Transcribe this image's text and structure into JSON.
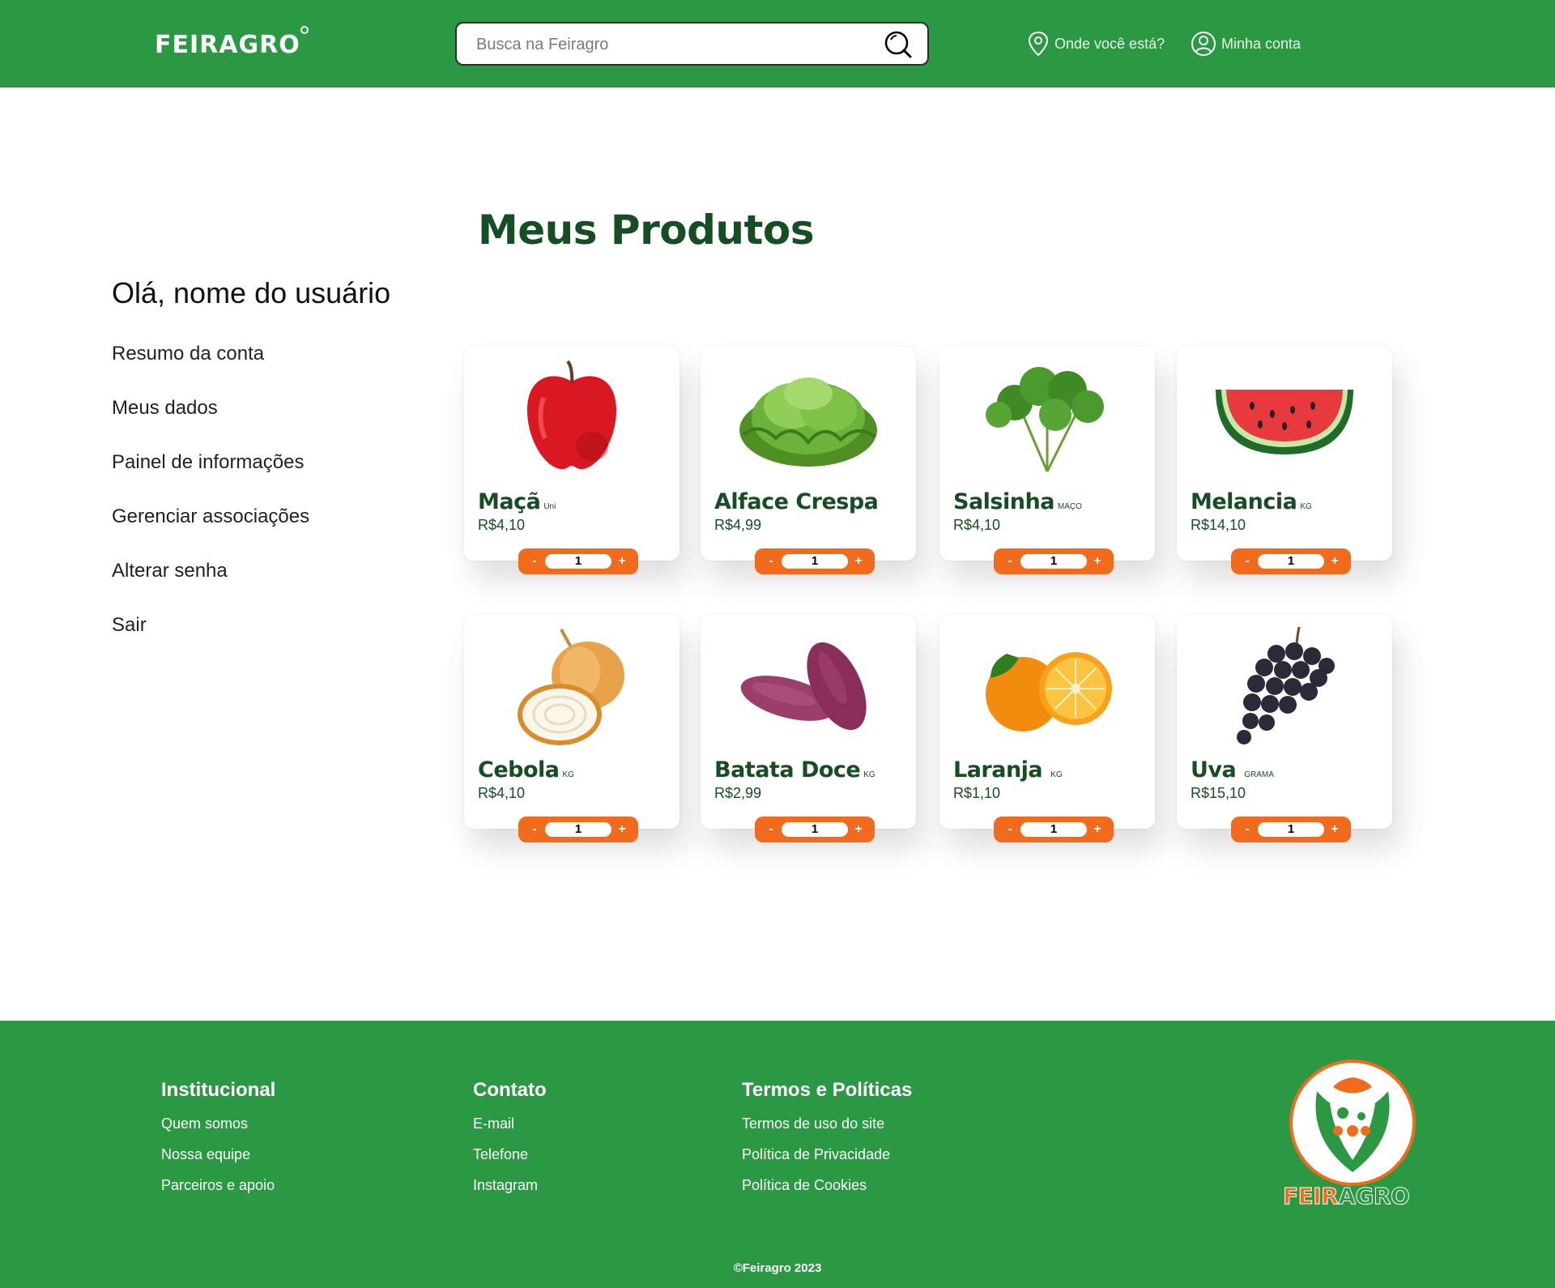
{
  "header": {
    "logo": "FEIRAGRO",
    "search_placeholder": "Busca na Feiragro",
    "location_label": "Onde você está?",
    "account_label": "Minha conta"
  },
  "sidebar": {
    "greeting": "Olá, nome do usuário",
    "items": [
      {
        "label": "Resumo da conta"
      },
      {
        "label": "Meus dados"
      },
      {
        "label": "Painel de informações"
      },
      {
        "label": "Gerenciar associações"
      },
      {
        "label": "Alterar senha"
      },
      {
        "label": "Sair"
      }
    ]
  },
  "main": {
    "title": "Meus Produtos",
    "products": [
      {
        "name": "Maçã",
        "unit": "Uni",
        "price": "R$4,10",
        "qty": "1",
        "icon": "apple-icon"
      },
      {
        "name": "Alface Crespa",
        "unit": "",
        "price": "R$4,99",
        "qty": "1",
        "icon": "lettuce-icon"
      },
      {
        "name": "Salsinha",
        "unit": "MAÇO",
        "price": "R$4,10",
        "qty": "1",
        "icon": "parsley-icon"
      },
      {
        "name": "Melancia",
        "unit": "KG",
        "price": "R$14,10",
        "qty": "1",
        "icon": "watermelon-icon"
      },
      {
        "name": "Cebola",
        "unit": "KG",
        "price": "R$4,10",
        "qty": "1",
        "icon": "onion-icon"
      },
      {
        "name": "Batata Doce",
        "unit": "KG",
        "price": "R$2,99",
        "qty": "1",
        "icon": "sweet-potato-icon"
      },
      {
        "name": "Laranja",
        "unit": "KG",
        "price": "R$1,10",
        "qty": "1",
        "icon": "orange-icon"
      },
      {
        "name": "Uva",
        "unit": "GRAMA",
        "price": "R$15,10",
        "qty": "1",
        "icon": "grape-icon"
      }
    ],
    "minus_label": "-",
    "plus_label": "+"
  },
  "footer": {
    "columns": [
      {
        "heading": "Institucional",
        "links": [
          "Quem somos",
          "Nossa equipe",
          "Parceiros e apoio"
        ]
      },
      {
        "heading": "Contato",
        "links": [
          "E-mail",
          "Telefone",
          "Instagram"
        ]
      },
      {
        "heading": "Termos e Políticas",
        "links": [
          "Termos de uso do site",
          "Política de Privacidade",
          "Política de Cookies"
        ]
      }
    ],
    "logo_word_a": "FEIR",
    "logo_word_b": "AGRO",
    "copyright": "©Feiragro 2023"
  },
  "colors": {
    "brand_green": "#2b9843",
    "dark_green": "#164d22",
    "accent_orange": "#f26b1d"
  }
}
